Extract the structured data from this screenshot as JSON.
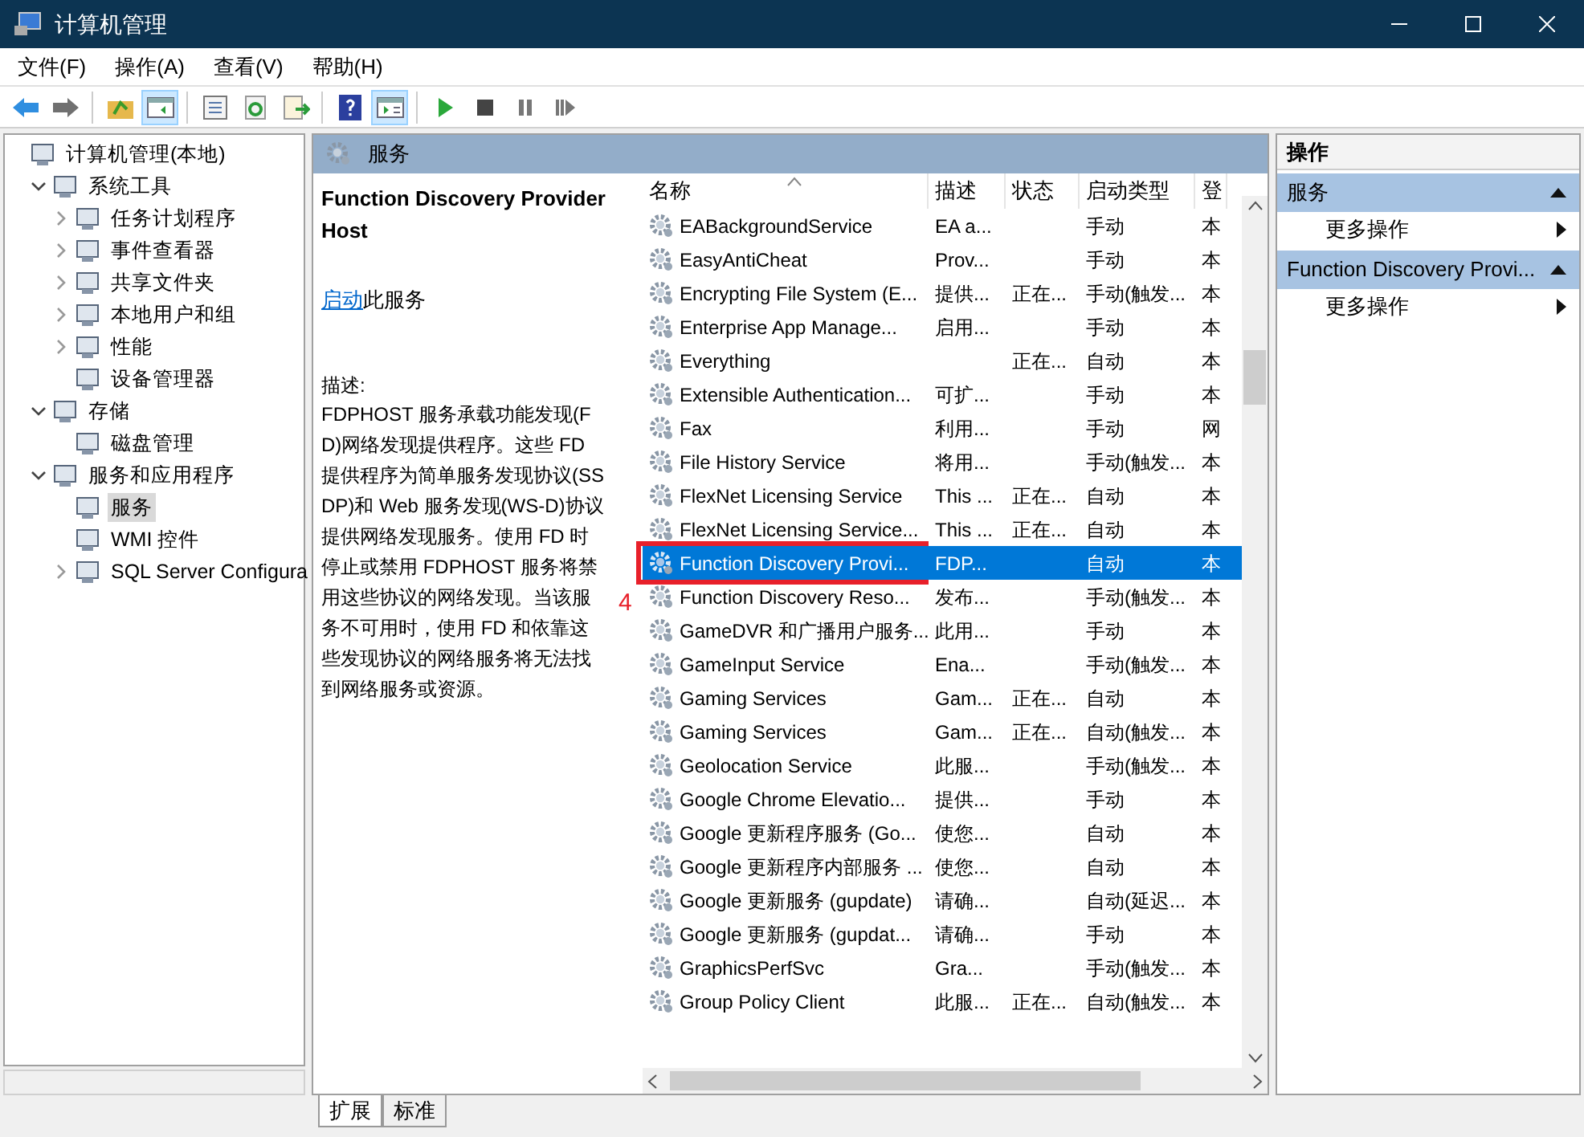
{
  "window": {
    "title": "计算机管理"
  },
  "menu": [
    "文件(F)",
    "操作(A)",
    "查看(V)",
    "帮助(H)"
  ],
  "toolbar": [
    [
      {
        "kind": "back",
        "selected": false
      },
      {
        "kind": "forward",
        "selected": false
      }
    ],
    [
      {
        "kind": "up",
        "selected": false
      },
      {
        "kind": "tree",
        "selected": true
      }
    ],
    [
      {
        "kind": "props",
        "selected": false
      },
      {
        "kind": "refresh",
        "selected": false
      },
      {
        "kind": "export",
        "selected": false
      }
    ],
    [
      {
        "kind": "help",
        "selected": false
      },
      {
        "kind": "pane",
        "selected": true
      }
    ],
    [
      {
        "kind": "play",
        "selected": false
      },
      {
        "kind": "stop",
        "selected": false
      },
      {
        "kind": "pause",
        "selected": false
      },
      {
        "kind": "resume",
        "selected": false
      }
    ]
  ],
  "tree": [
    {
      "label": "计算机管理(本地)",
      "selected": false,
      "children": [
        {
          "label": "系统工具",
          "expanded": true,
          "selected": false,
          "children": [
            {
              "label": "任务计划程序",
              "expanded": false,
              "selected": false
            },
            {
              "label": "事件查看器",
              "expanded": false,
              "selected": false
            },
            {
              "label": "共享文件夹",
              "expanded": false,
              "selected": false
            },
            {
              "label": "本地用户和组",
              "expanded": false,
              "selected": false
            },
            {
              "label": "性能",
              "expanded": false,
              "selected": false
            },
            {
              "label": "设备管理器",
              "selected": false
            }
          ]
        },
        {
          "label": "存储",
          "expanded": true,
          "selected": false,
          "children": [
            {
              "label": "磁盘管理",
              "selected": false
            }
          ]
        },
        {
          "label": "服务和应用程序",
          "expanded": true,
          "selected": false,
          "children": [
            {
              "label": "服务",
              "selected": true
            },
            {
              "label": "WMI 控件",
              "selected": false
            },
            {
              "label": "SQL Server Configura",
              "expanded": false,
              "selected": false
            }
          ]
        }
      ]
    }
  ],
  "center": {
    "title": "服务",
    "detail": {
      "name": "Function Discovery Provider Host",
      "link": "启动",
      "link_rest": "此服务",
      "desc_label": "描述:",
      "description": "FDPHOST 服务承载功能发现(FD)网络发现提供程序。这些 FD 提供程序为简单服务发现协议(SSDP)和 Web 服务发现(WS-D)协议提供网络发现服务。使用 FD 时停止或禁用 FDPHOST 服务将禁用这些协议的网络发现。当该服务不可用时，使用 FD 和依靠这些发现协议的网络服务将无法找到网络服务或资源。"
    },
    "table": {
      "columns": [
        "名称",
        "描述",
        "状态",
        "启动类型",
        "登"
      ],
      "rows": [
        {
          "name": "EABackgroundService",
          "desc": "EA a...",
          "status": "",
          "startup": "手动",
          "column_5": "本",
          "selected": false
        },
        {
          "name": "EasyAntiCheat",
          "desc": "Prov...",
          "status": "",
          "startup": "手动",
          "column_5": "本",
          "selected": false
        },
        {
          "name": "Encrypting File System (E...",
          "desc": "提供...",
          "status": "正在...",
          "startup": "手动(触发...",
          "column_5": "本",
          "selected": false
        },
        {
          "name": "Enterprise App Manage...",
          "desc": "启用...",
          "status": "",
          "startup": "手动",
          "column_5": "本",
          "selected": false
        },
        {
          "name": "Everything",
          "desc": "",
          "status": "正在...",
          "startup": "自动",
          "column_5": "本",
          "selected": false
        },
        {
          "name": "Extensible Authentication...",
          "desc": "可扩...",
          "status": "",
          "startup": "手动",
          "column_5": "本",
          "selected": false
        },
        {
          "name": "Fax",
          "desc": "利用...",
          "status": "",
          "startup": "手动",
          "column_5": "网",
          "selected": false
        },
        {
          "name": "File History Service",
          "desc": "将用...",
          "status": "",
          "startup": "手动(触发...",
          "column_5": "本",
          "selected": false
        },
        {
          "name": "FlexNet Licensing Service",
          "desc": "This ...",
          "status": "正在...",
          "startup": "自动",
          "column_5": "本",
          "selected": false
        },
        {
          "name": "FlexNet Licensing Service...",
          "desc": "This ...",
          "status": "正在...",
          "startup": "自动",
          "column_5": "本",
          "selected": false
        },
        {
          "name": "Function Discovery Provi...",
          "desc": "FDP...",
          "status": "",
          "startup": "自动",
          "column_5": "本",
          "selected": true
        },
        {
          "name": "Function Discovery Reso...",
          "desc": "发布...",
          "status": "",
          "startup": "手动(触发...",
          "column_5": "本",
          "selected": false
        },
        {
          "name": "GameDVR 和广播用户服务...",
          "desc": "此用...",
          "status": "",
          "startup": "手动",
          "column_5": "本",
          "selected": false
        },
        {
          "name": "GameInput Service",
          "desc": "Ena...",
          "status": "",
          "startup": "手动(触发...",
          "column_5": "本",
          "selected": false
        },
        {
          "name": "Gaming Services",
          "desc": "Gam...",
          "status": "正在...",
          "startup": "自动",
          "column_5": "本",
          "selected": false
        },
        {
          "name": "Gaming Services",
          "desc": "Gam...",
          "status": "正在...",
          "startup": "自动(触发...",
          "column_5": "本",
          "selected": false
        },
        {
          "name": "Geolocation Service",
          "desc": "此服...",
          "status": "",
          "startup": "手动(触发...",
          "column_5": "本",
          "selected": false
        },
        {
          "name": "Google Chrome Elevatio...",
          "desc": "提供...",
          "status": "",
          "startup": "手动",
          "column_5": "本",
          "selected": false
        },
        {
          "name": "Google 更新程序服务 (Go...",
          "desc": "使您...",
          "status": "",
          "startup": "自动",
          "column_5": "本",
          "selected": false
        },
        {
          "name": "Google 更新程序内部服务 ...",
          "desc": "使您...",
          "status": "",
          "startup": "自动",
          "column_5": "本",
          "selected": false
        },
        {
          "name": "Google 更新服务 (gupdate)",
          "desc": "请确...",
          "status": "",
          "startup": "自动(延迟...",
          "column_5": "本",
          "selected": false
        },
        {
          "name": "Google 更新服务 (gupdat...",
          "desc": "请确...",
          "status": "",
          "startup": "手动",
          "column_5": "本",
          "selected": false
        },
        {
          "name": "GraphicsPerfSvc",
          "desc": "Gra...",
          "status": "",
          "startup": "手动(触发...",
          "column_5": "本",
          "selected": false
        },
        {
          "name": "Group Policy Client",
          "desc": "此服...",
          "status": "正在...",
          "startup": "自动(触发...",
          "column_5": "本",
          "selected": false
        }
      ]
    },
    "annotation": {
      "label": "4"
    },
    "tabs": [
      {
        "label": "扩展",
        "selected": true
      },
      {
        "label": "标准",
        "selected": false
      }
    ]
  },
  "actions": {
    "title": "操作",
    "sections": [
      {
        "title": "服务",
        "items": [
          "更多操作"
        ]
      },
      {
        "title": "Function Discovery Provi...",
        "items": [
          "更多操作"
        ]
      }
    ]
  }
}
